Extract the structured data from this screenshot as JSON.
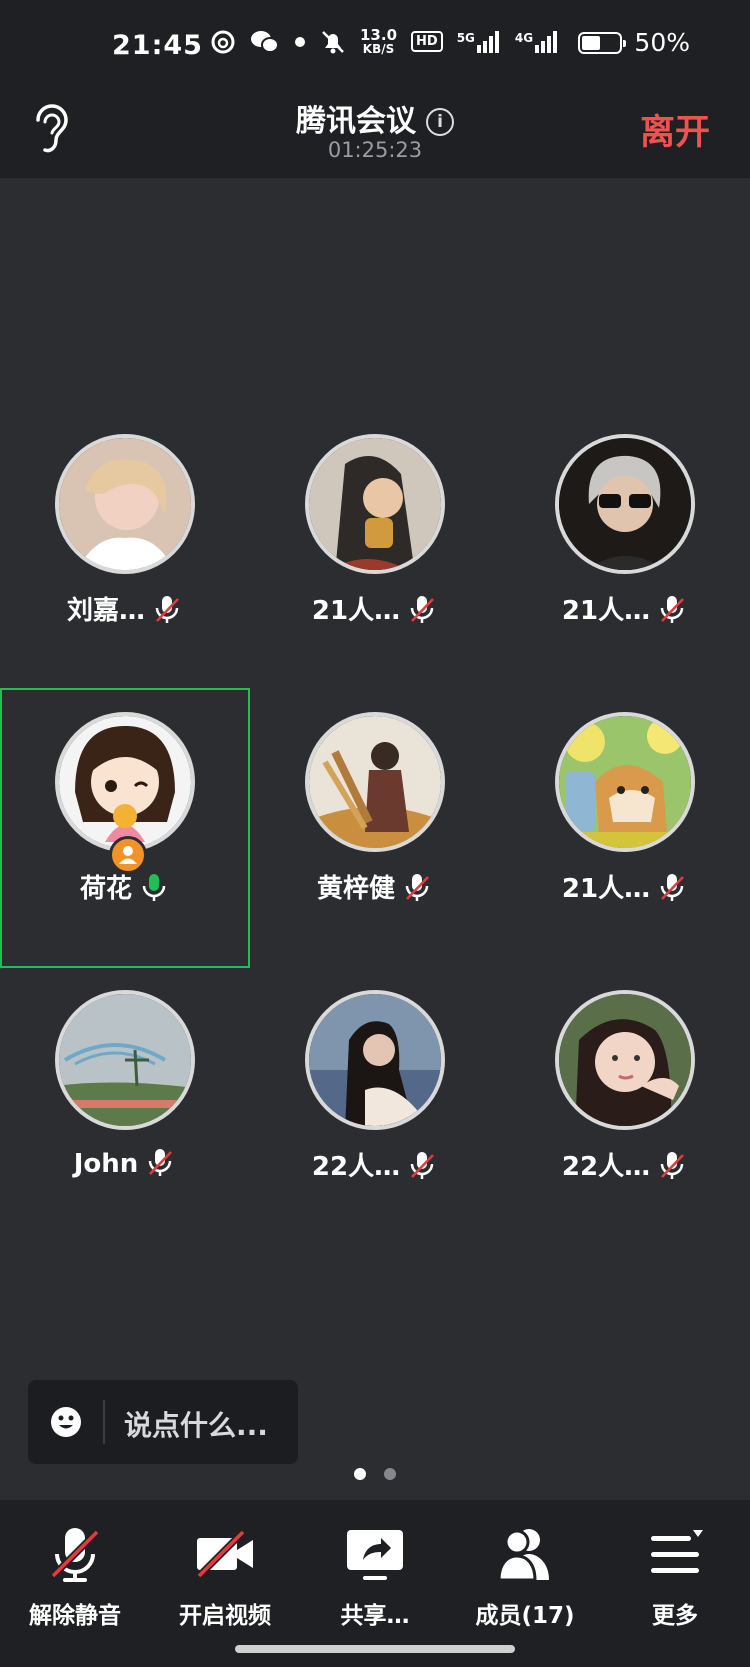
{
  "status_bar": {
    "time": "21:45",
    "net_speed_value": "13.0",
    "net_speed_unit": "KB/S",
    "hd": "HD",
    "sig1": "5G",
    "sig2": "4G",
    "battery_text": "50%",
    "battery_level": 0.5
  },
  "header": {
    "title": "腾讯会议",
    "timer": "01:25:23",
    "leave": "离开"
  },
  "participants": [
    {
      "name": "刘嘉…",
      "mic": "muted"
    },
    {
      "name": "21人…",
      "mic": "muted"
    },
    {
      "name": "21人…",
      "mic": "muted"
    },
    {
      "name": "荷花",
      "mic": "on",
      "host": true,
      "speaking": true
    },
    {
      "name": "黄梓健",
      "mic": "muted"
    },
    {
      "name": "21人…",
      "mic": "muted"
    },
    {
      "name": "John",
      "mic": "muted"
    },
    {
      "name": "22人…",
      "mic": "muted"
    },
    {
      "name": "22人…",
      "mic": "muted"
    }
  ],
  "chat": {
    "placeholder": "说点什么..."
  },
  "pager": {
    "pages": 2,
    "current": 1
  },
  "toolbar": {
    "unmute": "解除静音",
    "video": "开启视频",
    "share": "共享…",
    "members": "成员(17)",
    "more": "更多"
  },
  "colors": {
    "accent_green": "#1fbf58",
    "leave_red": "#f05151",
    "mute_red": "#e33b3b",
    "host_orange": "#f29228"
  }
}
